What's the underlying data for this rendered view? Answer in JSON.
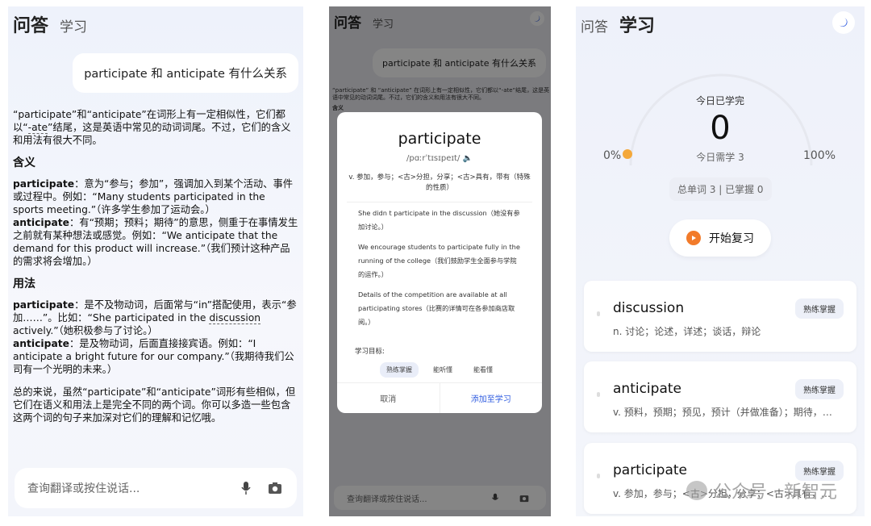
{
  "panel1": {
    "tab_active": "问答",
    "tab_inactive": "学习",
    "question": "participate 和 anticipate 有什么关系",
    "intro_a": "“participate”和“anticipate”在词形上有一定相似性，它们都以“",
    "intro_ul": "-ate",
    "intro_b": "”结尾，这是英语中常见的动词词尾。不过，它们的含义和用法有很大不同。",
    "meaning_heading": "含义",
    "m1_word": "participate",
    "m1_text": "：意为“参与；参加”，强调加入到某个活动、事件或过程中。例如：“Many students participated in the sports meeting.”（许多学生参加了运动会。）",
    "m2_word": "anticipate",
    "m2_text": "：有“预期；预料；期待”的意思，侧重于在事情发生之前就有某种想法或感觉。例如：“We anticipate that the demand for this product will increase.”（我们预计这种产品的需求将会增加。）",
    "usage_heading": "用法",
    "u1_word": "participate",
    "u1_text_a": "：是不及物动词，后面常与“in”搭配使用，表示“参加……”。比如：“She participated in the ",
    "u1_ul": "discussion",
    "u1_text_b": " actively.”（她积极参与了讨论。）",
    "u2_word": "anticipate",
    "u2_text": "：是及物动词，后面直接接宾语。例如：“I anticipate a bright future for our company.”（我期待我们公司有一个光明的未来。）",
    "summary": "总的来说，虽然“participate”和“anticipate”词形有些相似，但它们在语义和用法上是完全不同的两个词。你可以多造一些包含这两个词的句子来加深对它们的理解和记忆哦。",
    "input_placeholder": "查询翻译或按住说话..."
  },
  "panel2": {
    "tab_active": "问答",
    "tab_inactive": "学习",
    "question": "participate 和 anticipate 有什么关系",
    "bg_line1": "“participate” 和 “anticipate” 在词形上有一定相似性，它们都以“-ate”结尾，这是英语中常见的动词词尾。不过，它们的含义和用法有很大不同。",
    "bg_heading": "含义",
    "word": "participate",
    "pronunciation": "/pɑːrˈtɪsɪpeɪt/",
    "definition": "v. 参加，参与；<古>分担，分享；<古>具有，带有（特殊的性质）",
    "examples": [
      "She didn t participate in the discussion（她没有参加讨论。）",
      "We encourage students to participate fully in the running of the college（我们鼓励学生全面参与学院的运作。）",
      "Details of the competition are available at all participating stores（比赛的详情可在各参加商店取阅。）"
    ],
    "goal_label": "学习目标:",
    "goals": [
      "熟练掌握",
      "能听懂",
      "能看懂"
    ],
    "cancel": "取消",
    "add": "添加至学习",
    "input_placeholder": "查询翻译或按住说话..."
  },
  "panel3": {
    "tab_inactive": "问答",
    "tab_active": "学习",
    "learned_title": "今日已学完",
    "learned_count": "0",
    "need_label": "今日需学 3",
    "progress_fraction": 0,
    "pct_min": "0%",
    "pct_max": "100%",
    "totals": "总单词 3 | 已掌握 0",
    "review_button": "开始复习",
    "cards": [
      {
        "word": "discussion",
        "meaning": "n. 讨论；论述，详述；谈话，辩论",
        "badge": "熟练掌握"
      },
      {
        "word": "anticipate",
        "meaning": "v. 预料，预期；预见，预计（并做准备）；期待，盼望",
        "badge": "熟练掌握"
      },
      {
        "word": "participate",
        "meaning": "v. 参加，参与；<古>分担，分享；<古>具有，带有",
        "badge": "熟练掌握"
      }
    ],
    "watermark": "公众号 · 新智元"
  },
  "colors": {
    "accent_blue": "#2f5ce0",
    "orange": "#f27b2a",
    "progress_dot": "#f4a83a"
  }
}
